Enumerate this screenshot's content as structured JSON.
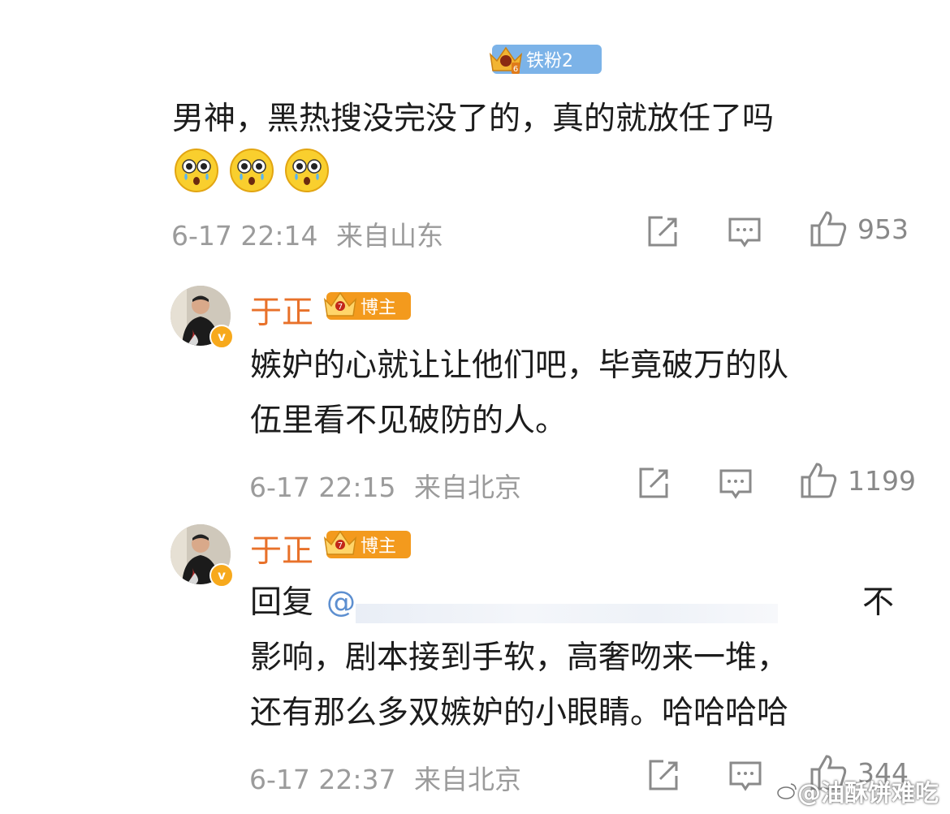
{
  "comment1": {
    "fan_badge": "铁粉2",
    "text_line1": "男神，黑热搜没完没了的，真的就放任了吗",
    "emoji_icon": "crying-surprised-emoji",
    "time": "6-17 22:14",
    "location": "来自山东",
    "likes": "953"
  },
  "reply1": {
    "name": "于正",
    "role_badge": "博主",
    "text_line1": "嫉妒的心就让让他们吧，毕竟破万的队",
    "text_line2": "伍里看不见破防的人。",
    "time": "6-17 22:15",
    "location": "来自北京",
    "likes": "1199"
  },
  "reply2": {
    "name": "于正",
    "role_badge": "博主",
    "reply_prefix": "回复",
    "mention": "@",
    "text_line1_end": "不",
    "text_line2": "影响，剧本接到手软，高奢吻来一堆，",
    "text_line3": "还有那么多双嫉妒的小眼睛。哈哈哈哈",
    "time": "6-17 22:37",
    "location": "来自北京",
    "likes": "344"
  },
  "watermark": "@油酥饼难吃",
  "colors": {
    "name": "#e8712a",
    "fan_badge": "#7cb3e8",
    "host_badge": "#f39a1d",
    "meta": "#9b9b9b"
  }
}
